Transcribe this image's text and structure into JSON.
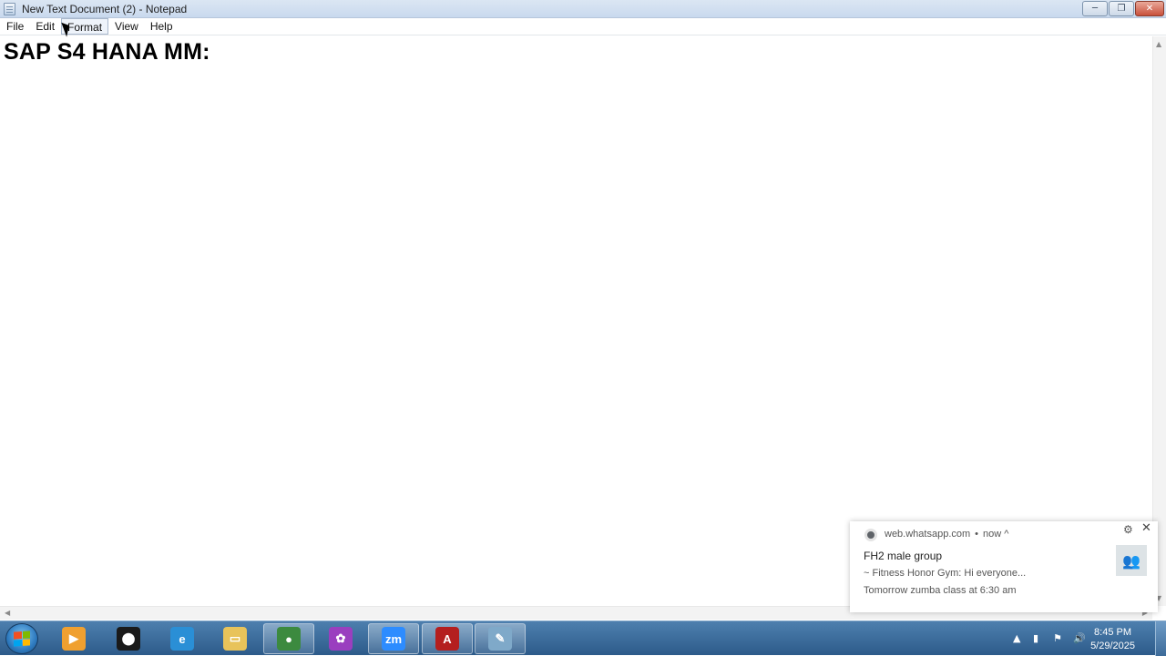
{
  "window": {
    "title": "New Text Document (2) - Notepad",
    "minimize_glyph": "─",
    "restore_glyph": "❐",
    "close_glyph": "✕"
  },
  "menu": {
    "items": [
      "File",
      "Edit",
      "Format",
      "View",
      "Help"
    ]
  },
  "editor": {
    "text": "SAP S4 HANA MM:"
  },
  "notification": {
    "source": "web.whatsapp.com",
    "time": "now",
    "expand_glyph": "^",
    "title": "FH2 male group",
    "line1": "~ Fitness Honor Gym: Hi everyone...",
    "line2": "Tomorrow zumba class at 6:30 am",
    "gear_glyph": "⚙",
    "close_glyph": "✕"
  },
  "taskbar": {
    "apps": [
      {
        "name": "media-player",
        "label": "▶",
        "color": "#f0a030"
      },
      {
        "name": "app-pin",
        "label": "⬤",
        "color": "#1a1a1a"
      },
      {
        "name": "internet-explorer",
        "label": "e",
        "color": "#2a8fd6"
      },
      {
        "name": "file-explorer",
        "label": "▭",
        "color": "#e8c35a"
      },
      {
        "name": "chrome",
        "label": "●",
        "color": "#3c8a3f"
      },
      {
        "name": "colorful-app",
        "label": "✿",
        "color": "#9a3fbf"
      },
      {
        "name": "zoom",
        "label": "zm",
        "color": "#2d8cff"
      },
      {
        "name": "acrobat",
        "label": "A",
        "color": "#b41f1f"
      },
      {
        "name": "notepad",
        "label": "✎",
        "color": "#7fa9c9"
      }
    ],
    "clock_time": "8:45 PM",
    "clock_date": "5/29/2025"
  },
  "colors": {
    "taskbar": "#2d5b8a",
    "titlebar": "#c9d9ee"
  }
}
